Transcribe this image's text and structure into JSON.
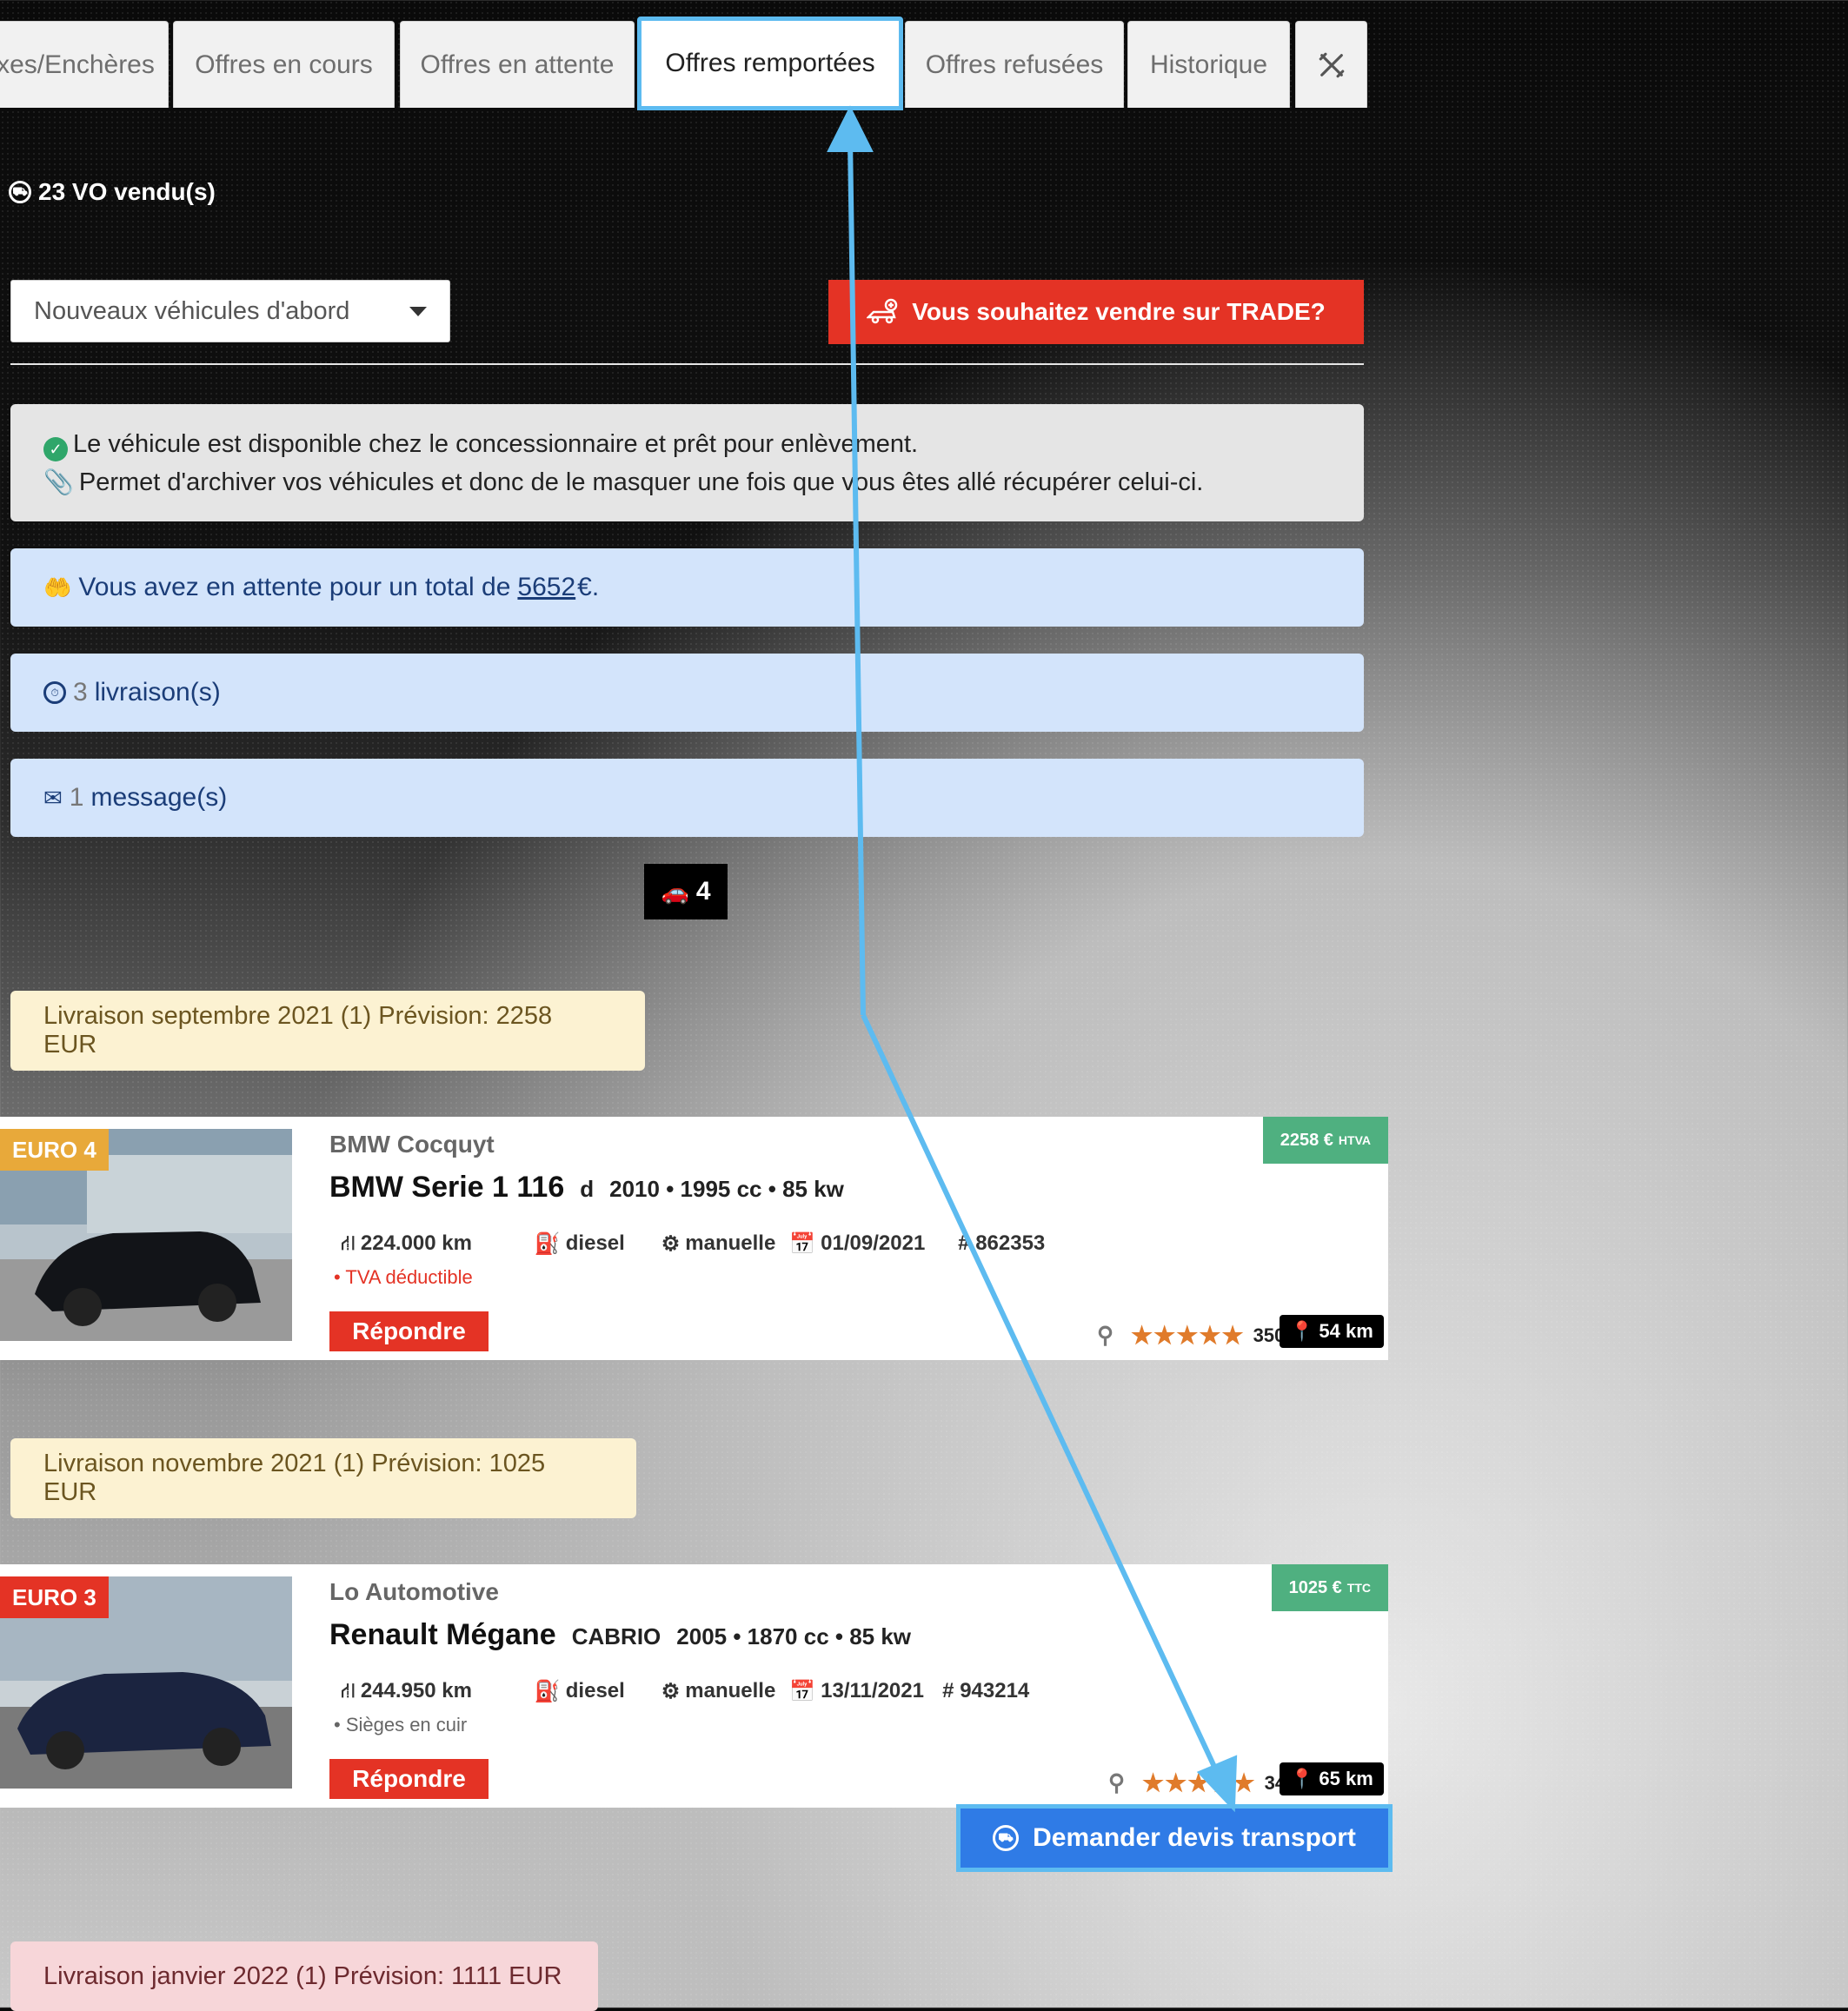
{
  "tabs": [
    {
      "label": "xes/Enchères"
    },
    {
      "label": "Offres en cours"
    },
    {
      "label": "Offres en attente"
    },
    {
      "label": "Offres remportées"
    },
    {
      "label": "Offres refusées"
    },
    {
      "label": "Historique"
    }
  ],
  "sold_text": "23 VO vendu(s)",
  "sort_select": {
    "value": "Nouveaux véhicules d'abord"
  },
  "sell_button": "Vous souhaitez vendre sur TRADE?",
  "info": {
    "line1": "Le véhicule est disponible chez le concessionnaire et prêt pour enlèvement.",
    "line2": "Permet d'archiver vos véhicules et donc de le masquer une fois que vous êtes allé récupérer celui-ci."
  },
  "pending": {
    "prefix": "Vous avez en attente pour un total de",
    "amount": "5652",
    "suffix": "€."
  },
  "deliveries_count": {
    "number": "3",
    "label": "livraison(s)"
  },
  "messages_count": {
    "number": "1",
    "label": "message(s)"
  },
  "vehicle_count": "4",
  "groups": [
    {
      "label": "Livraison septembre 2021 (1) Prévision: 2258 EUR"
    },
    {
      "label": "Livraison novembre 2021 (1) Prévision: 1025 EUR"
    },
    {
      "label": "Livraison janvier 2022 (1) Prévision: 1111 EUR"
    }
  ],
  "cars": [
    {
      "euro": "EURO 4",
      "euro_color": "#e8a93a",
      "seller": "BMW Cocquyt",
      "model": "BMW Serie 1 116",
      "variant": "d",
      "details": "2010 • 1995 cc • 85 kw",
      "mileage": "224.000 km",
      "fuel": "diesel",
      "gearbox": "manuelle",
      "date": "01/09/2021",
      "ref": "# 862353",
      "note": "• TVA déductible",
      "note_color": "#e43325",
      "reply": "Répondre",
      "price": "2258 €",
      "price_tax": "HTVA",
      "rating_count": "350",
      "distance": "54 km",
      "stars": "★★★★★"
    },
    {
      "euro": "EURO 3",
      "euro_color": "#e43325",
      "seller": "Lo Automotive",
      "model": "Renault Mégane",
      "variant": "CABRIO",
      "details": "2005 • 1870 cc • 85 kw",
      "mileage": "244.950 km",
      "fuel": "diesel",
      "gearbox": "manuelle",
      "date": "13/11/2021",
      "ref": "# 943214",
      "note": "• Sièges en cuir",
      "note_color": "#666666",
      "reply": "Répondre",
      "price": "1025 €",
      "price_tax": "TTC",
      "rating_count": "34",
      "distance": "65 km",
      "stars": "★★★★★"
    }
  ],
  "transport_button": "Demander devis transport",
  "colors": {
    "accent_red": "#e43325",
    "highlight_blue": "#5dbbf0",
    "price_green": "#4fb080",
    "transport_blue": "#2f7be6"
  }
}
